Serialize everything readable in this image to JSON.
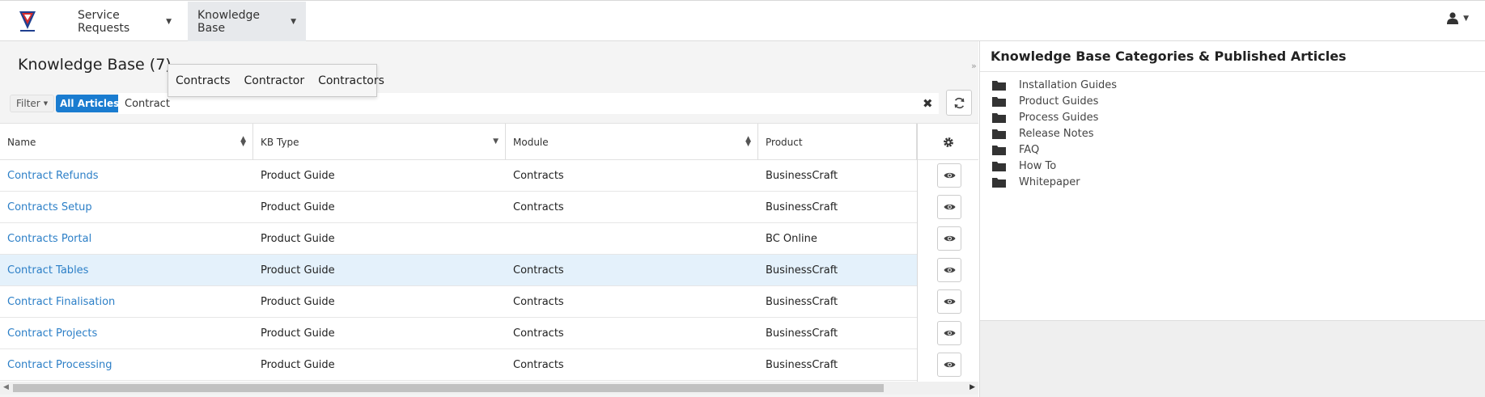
{
  "nav": {
    "items": [
      {
        "label": "Service Requests"
      },
      {
        "label": "Knowledge Base"
      }
    ]
  },
  "page": {
    "title": "Knowledge Base (7)"
  },
  "filter": {
    "label": "Filter",
    "tag": "All Articles",
    "search_value": "Contract"
  },
  "autocomplete": [
    "Contracts",
    "Contractor",
    "Contractors"
  ],
  "table": {
    "columns": [
      "Name",
      "KB Type",
      "Module",
      "Product"
    ],
    "rows": [
      {
        "name": "Contract Refunds",
        "kb_type": "Product Guide",
        "module": "Contracts",
        "product": "BusinessCraft"
      },
      {
        "name": "Contracts Setup",
        "kb_type": "Product Guide",
        "module": "Contracts",
        "product": "BusinessCraft"
      },
      {
        "name": "Contracts Portal",
        "kb_type": "Product Guide",
        "module": "",
        "product": "BC Online"
      },
      {
        "name": "Contract Tables",
        "kb_type": "Product Guide",
        "module": "Contracts",
        "product": "BusinessCraft"
      },
      {
        "name": "Contract Finalisation",
        "kb_type": "Product Guide",
        "module": "Contracts",
        "product": "BusinessCraft"
      },
      {
        "name": "Contract Projects",
        "kb_type": "Product Guide",
        "module": "Contracts",
        "product": "BusinessCraft"
      },
      {
        "name": "Contract Processing",
        "kb_type": "Product Guide",
        "module": "Contracts",
        "product": "BusinessCraft"
      }
    ]
  },
  "categories": {
    "title": "Knowledge Base Categories & Published Articles",
    "items": [
      "Installation Guides",
      "Product Guides",
      "Process Guides",
      "Release Notes",
      "FAQ",
      "How To",
      "Whitepaper"
    ]
  },
  "colors": {
    "accent": "#1a7cd0",
    "link": "#2c7fc7",
    "row_highlight": "#e4f1fb",
    "logo_red": "#d52b2b",
    "logo_blue": "#1f3f8f"
  },
  "icons": {
    "logo": "company-logo",
    "user": "user-icon",
    "refresh": "refresh-icon",
    "clear": "clear-icon",
    "settings": "gear-icon",
    "view": "eye-icon",
    "folder": "folder-icon"
  }
}
